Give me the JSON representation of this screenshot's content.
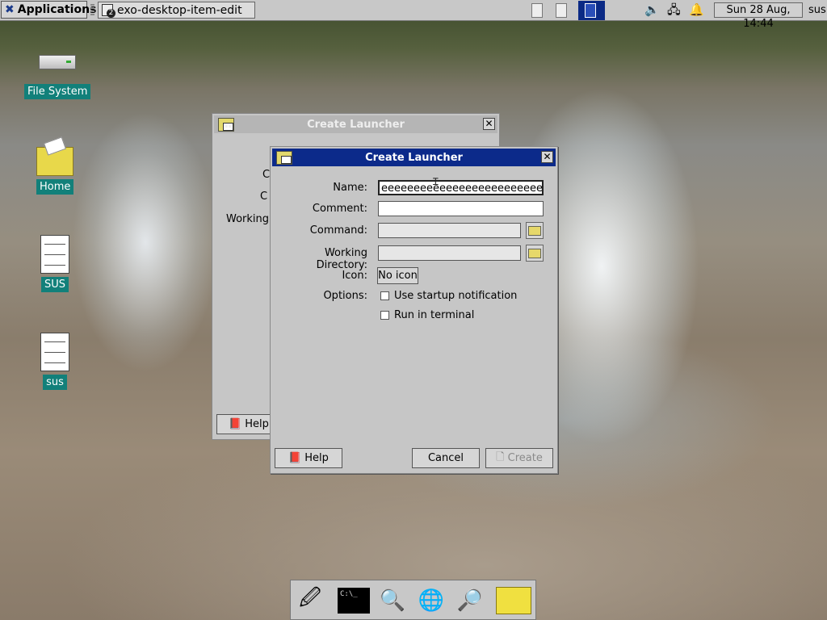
{
  "panel": {
    "applications_label": "Applications",
    "task_title": "exo-desktop-item-edit",
    "task_badge": "2",
    "clock": "Sun 28 Aug, 14:44",
    "user": "sus"
  },
  "desktop_icons": {
    "file_system": "File System",
    "home": "Home",
    "sus_upper": "SUS",
    "sus_lower": "sus"
  },
  "back_window": {
    "title": "Create Launcher",
    "labels_partial": [
      "C",
      "C",
      "Working D"
    ],
    "help_label": "Help"
  },
  "dialog": {
    "title": "Create Launcher",
    "labels": {
      "name": "Name:",
      "comment": "Comment:",
      "command": "Command:",
      "working_directory": "Working Directory:",
      "icon": "Icon:",
      "options": "Options:"
    },
    "values": {
      "name": "eeeeeeeeeeeeeeeeeeeeeeeeeeeeeee",
      "comment": "",
      "command": "",
      "working_directory": ""
    },
    "icon_button": "No icon",
    "options": {
      "startup_notification": "Use startup notification",
      "run_in_terminal": "Run in terminal"
    },
    "buttons": {
      "help": "Help",
      "cancel": "Cancel",
      "create": "Create"
    }
  },
  "dock": {
    "terminal_text": "C:\\_"
  },
  "colors": {
    "title_active": "#0c2a8a",
    "desktop_label_bg": "#12807a",
    "window_bg": "#c6c6c6"
  }
}
